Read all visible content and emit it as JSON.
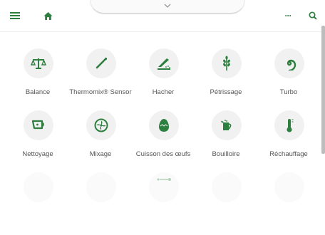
{
  "colors": {
    "brand_green": "#2d7f3f",
    "circle_bg": "#f1f1f1"
  },
  "topbar": {
    "menu_icon": "hamburger-icon",
    "home_icon": "home-icon",
    "pulltab_icon": "chevron-down-icon",
    "more_label": "···",
    "search_icon": "search-icon"
  },
  "modes": [
    {
      "label": "Balance",
      "icon": "scale-icon"
    },
    {
      "label": "Thermomix® Sensor",
      "icon": "thermometer-probe-icon"
    },
    {
      "label": "Hacher",
      "icon": "knife-board-icon"
    },
    {
      "label": "Pétrissage",
      "icon": "wheat-icon"
    },
    {
      "label": "Turbo",
      "icon": "turbo-spiral-icon"
    },
    {
      "label": "Nettoyage",
      "icon": "cleaning-bowl-icon"
    },
    {
      "label": "Mixage",
      "icon": "blender-blade-icon"
    },
    {
      "label": "Cuisson des œufs",
      "icon": "egg-icon"
    },
    {
      "label": "Bouilloire",
      "icon": "kettle-icon"
    },
    {
      "label": "Réchauffage",
      "icon": "warming-thermometer-icon"
    }
  ]
}
